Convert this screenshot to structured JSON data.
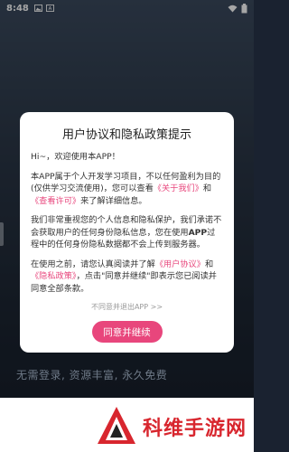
{
  "status_bar": {
    "time": "8:48",
    "icons_left": [
      "image-icon",
      "a-icon"
    ],
    "icons_right": [
      "wifi-icon",
      "battery-icon"
    ]
  },
  "background": {
    "slogan": "无需登录, 资源丰富, 永久免费"
  },
  "dialog": {
    "title": "用户协议和隐私政策提示",
    "greeting": "Hi~，欢迎使用本APP！",
    "p1": {
      "t1": "本APP属于个人开发学习项目，不以任何盈利为目的(仅供学习交流使用)，您可以查看",
      "link_about": "《关于我们》",
      "t2": "和",
      "link_permission": "《查看许可》",
      "t3": "来了解详细信息。"
    },
    "p2": {
      "t1": "我们非常重视您的个人信息和隐私保护，我们承诺不会获取用户的任何身份隐私信息，您在使用",
      "bold": "APP",
      "t2": "过程中的任何身份隐私数据都不会上传到服务器。"
    },
    "p3": {
      "t1": "在使用之前，请您认真阅读并了解",
      "link_agreement": "《用户协议》",
      "t2": "和",
      "link_privacy": "《隐私政策》",
      "t3": "，点击\"同意并继续\"即表示您已阅读并同意全部条款。"
    },
    "decline_label": "不同意并退出APP >>",
    "accept_label": "同意并继续"
  },
  "branding": {
    "name": "科维手游网"
  },
  "colors": {
    "accent": "#e8467c",
    "brand_red": "#d8262e"
  }
}
